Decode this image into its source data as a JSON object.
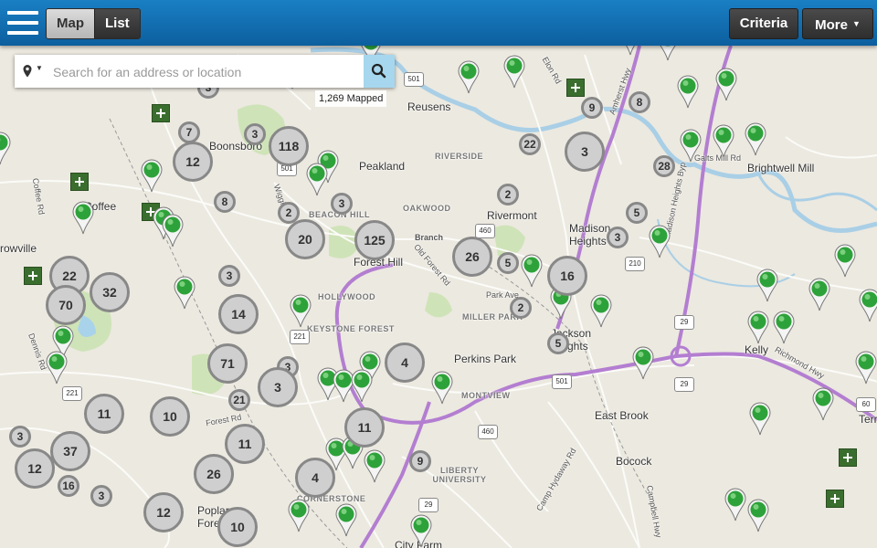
{
  "topbar": {
    "map_label": "Map",
    "list_label": "List",
    "criteria_label": "Criteria",
    "more_label": "More",
    "more_caret": "▼"
  },
  "search": {
    "placeholder": "Search for an address or location",
    "value": "",
    "location_caret": "▼"
  },
  "mapped_count": "1,269 Mapped",
  "colors": {
    "topbar": "#1a7fc4",
    "cluster_fill": "#cfcfcf",
    "cluster_border": "#888888",
    "pin_green": "#2ea23a",
    "plus_green": "#3a6e2e",
    "search_button": "#a6d7ee"
  },
  "clusters": [
    "3",
    "7",
    "3",
    "118",
    "12",
    "8",
    "2",
    "3",
    "20",
    "125",
    "3",
    "26",
    "5",
    "16",
    "2",
    "5",
    "3",
    "22",
    "32",
    "70",
    "14",
    "71",
    "3",
    "21",
    "4",
    "11",
    "10",
    "11",
    "11",
    "37",
    "12",
    "16",
    "3",
    "9",
    "4",
    "26",
    "12",
    "10",
    "22",
    "8",
    "9",
    "3",
    "28",
    "2",
    "5",
    "3",
    "3"
  ],
  "places": [
    "Reusens",
    "Boonsboro",
    "Peakland",
    "Coffee",
    "RIVERSIDE",
    "OAKWOOD",
    "Rivermont",
    "Madison Heights",
    "BEACON HILL",
    "Branch",
    "Forest Hill",
    "Brightwell Mill",
    "rowville",
    "HOLLYWOOD",
    "KEYSTONE FOREST",
    "MILLER PARK",
    "Jackson Heights",
    "Perkins Park",
    "Kelly",
    "East Brook",
    "Bocock",
    "MONTVIEW",
    "LIBERTY UNIVERSITY",
    "CORNERSTONE",
    "Poplar Forest",
    "City Farm",
    "Galts Mill Rd",
    "Madison Heights Byp",
    "Richmond Hwy",
    "Elon Rd",
    "Amherst Hwy",
    "Forest Rd",
    "Old Forest Rd",
    "Wiggington Rd",
    "Coffee Rd",
    "Dennis Rd",
    "Campbell Hwy",
    "Camp Hydaway Rd",
    "Park Ave",
    "Terr"
  ],
  "road_shields": [
    "501",
    "501",
    "221",
    "221",
    "29",
    "29",
    "210",
    "460",
    "460",
    "501",
    "60",
    "29"
  ]
}
